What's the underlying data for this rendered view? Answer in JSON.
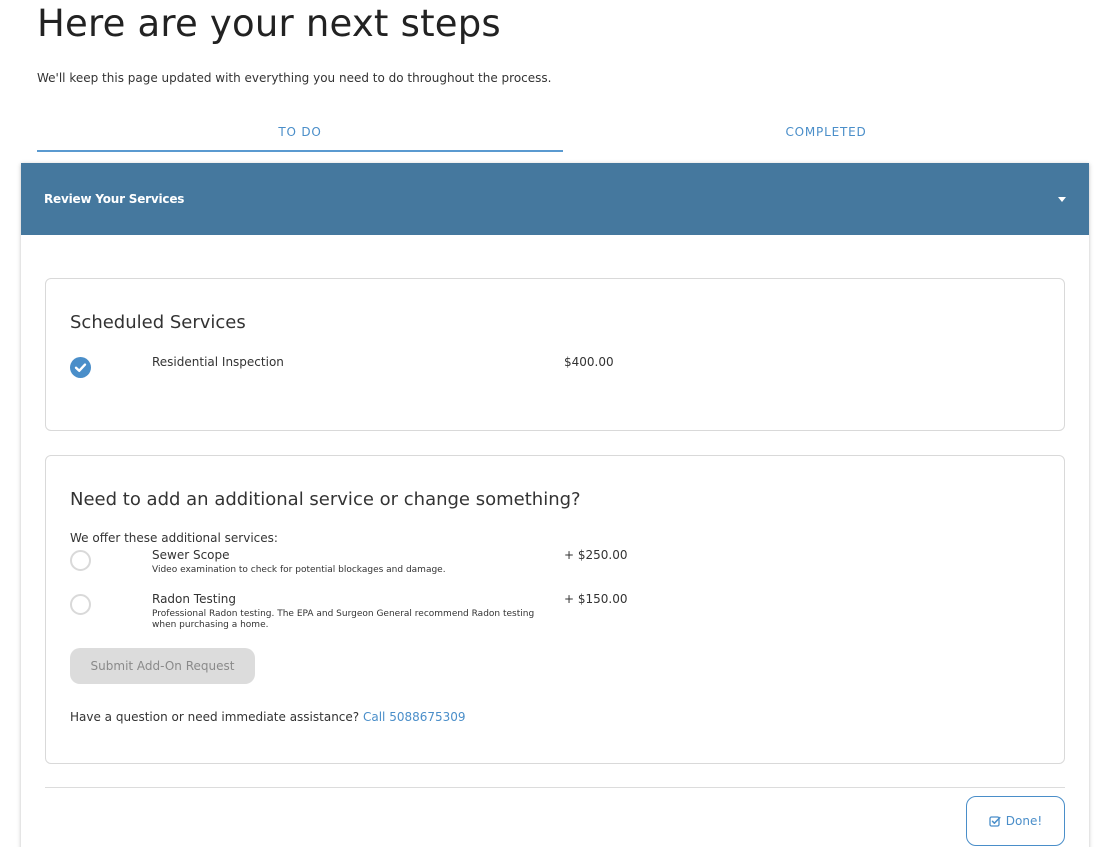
{
  "page": {
    "title": "Here are your next steps",
    "subtitle": "We'll keep this page updated with everything you need to do throughout the process."
  },
  "tabs": [
    {
      "label": "TO DO",
      "active": true
    },
    {
      "label": "COMPLETED",
      "active": false
    }
  ],
  "section": {
    "title": "Review Your Services",
    "toggle_icon": "caret-down-icon"
  },
  "scheduled": {
    "title": "Scheduled Services",
    "items": [
      {
        "name": "Residential Inspection",
        "price": "$400.00",
        "icon": "check-circle-icon"
      }
    ]
  },
  "additional": {
    "title": "Need to add an additional service or change something?",
    "offer_label": "We offer these additional services:",
    "items": [
      {
        "name": "Sewer Scope",
        "description": "Video examination to check for potential blockages and damage.",
        "price": "+ $250.00"
      },
      {
        "name": "Radon Testing",
        "description": "Professional Radon testing. The EPA and Surgeon General recommend Radon testing when purchasing a home.",
        "price": "+ $150.00"
      }
    ],
    "submit_label": "Submit Add-On Request",
    "help_text": "Have a question or need immediate assistance?",
    "help_link": "Call 5088675309"
  },
  "footer": {
    "done_label": "Done!",
    "done_icon": "check-square-icon"
  },
  "colors": {
    "accent": "#4a8ec9",
    "header_bg": "#45789e",
    "disabled_bg": "#dcdcdc"
  }
}
